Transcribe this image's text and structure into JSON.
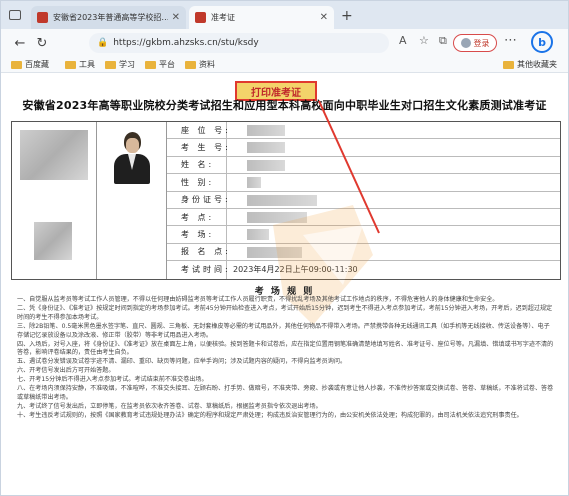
{
  "browser": {
    "tabs": [
      {
        "title": "安徽省2023年普通高等学校招…",
        "active": false
      },
      {
        "title": "准考证",
        "active": true
      }
    ],
    "address_url": "https://gkbm.ahzsks.cn/stu/ksdy",
    "login_label": "登录",
    "bookmarks": [
      "百度藏",
      "工具",
      "学习",
      "平台",
      "资料"
    ],
    "bookmarks_other": "其他收藏夹",
    "accent_color": "#1a73e8"
  },
  "page": {
    "print_button": "打印准考证",
    "doc_title": "安徽省2023年高等职业院校分类考试招生和应用型本科高校面向中职毕业生对口招生文化素质测试准考证",
    "fields": [
      {
        "label": "座 位 号:",
        "value": ""
      },
      {
        "label": "考 生 号:",
        "value": ""
      },
      {
        "label": "姓    名:",
        "value": ""
      },
      {
        "label": "性    别:",
        "value": ""
      },
      {
        "label": "身份证号:",
        "value": ""
      },
      {
        "label": "考    点:",
        "value": ""
      },
      {
        "label": "考    场:",
        "value": ""
      },
      {
        "label": "报 名 点:",
        "value": ""
      },
      {
        "label": "考试时间:",
        "value": "2023年4月22日上午09:00-11:30"
      }
    ],
    "rules_title": "考 场 规 则",
    "rules": [
      "一、自觉服从监考员等考试工作人员管理，不得以任何理由妨碍监考员等考试工作人员履行职责，不得扰乱考场及其他考试工作地点的秩序，不得危害他人的身体健康和生命安全。",
      "二、凭《身份证》、《准考证》按规定时间到指定的考场参加考试。考前45分钟开始检查进入考点，考试开始后15分钟，迟到考生不得进入考点参加考试，考前15分钟进入考场，开考后，迟到超过规定时间的考生不得参加本场考试。",
      "三、除2B铅笔、0.5毫米黑色墨水签字笔、直尺、圆规、三角板、无封套橡皮等必需的考试用品外，其他任何物品不得带入考场。严禁携带各种无线通讯工具（如手机等无线接收、传送设备等）、电子存储记忆录放设备以及涂改液、修正带（胶带）等非考试用品进入考场。",
      "四、入场后，对号入座，将《身份证》、《准考证》放在桌面左上角，以便核验。按到答题卡和试卷后，应在指定位置用钢笔准确清楚地填写姓名、准考证号、座位号等。凡漏填、错填或书写字迹不清的答卷，影响评卷结果的，责任由考生自负。",
      "五、遇试卷分发错误及试卷字迹不清、漏印、重印、缺页等问题，应举手询问；涉及试题内容的疑问，不得向监考员询问。",
      "六、开考信号发出后方可开始答题。",
      "七、开考15分钟后不得进入考点参加考试。考试结束前不准交卷出场。",
      "八、在考场内须保持安静，不准吸烟，不准喧哗，不准交头接耳、左顾右盼、打手势、做暗号，不准夹带、旁窥、抄袭或有意让他人抄袭，不准传抄答案或交换试卷、答卷、草稿纸，不准将试卷、答卷或草稿纸带出考场。",
      "九、考试终了信号发出后，立即停笔，在监考员依次收齐答卷、试卷、草稿纸后，根据监考员指令依次退出考场。",
      "十、考生违反考试规则的，按照《国家教育考试违规处理办法》确定的程序和规定严肃处理；构成违反治安管理行为的，由公安机关依法处理；构成犯罪的，由司法机关依法追究刑事责任。"
    ]
  }
}
